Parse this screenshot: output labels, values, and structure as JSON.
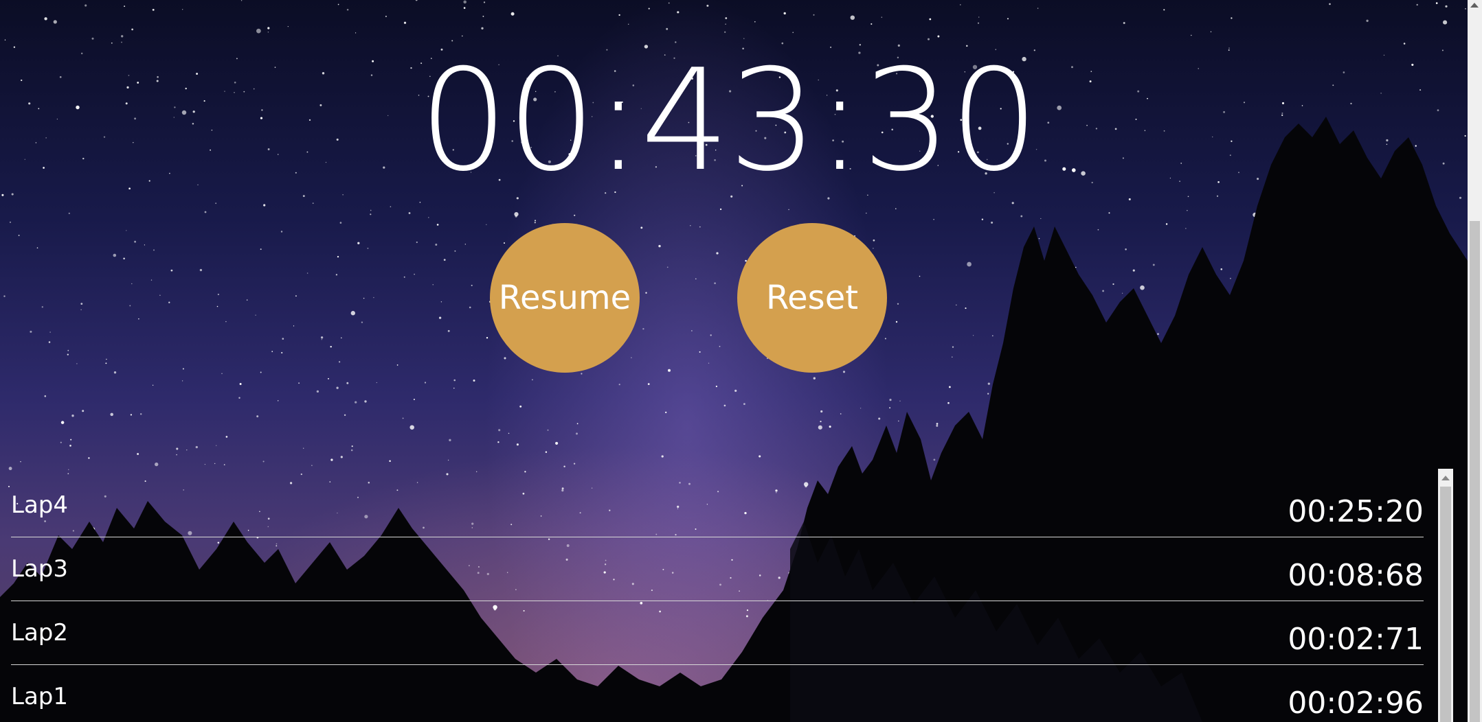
{
  "stopwatch": {
    "display": "00:43:30",
    "resume_label": "Resume",
    "reset_label": "Reset",
    "button_color": "#d4a04e"
  },
  "laps": [
    {
      "name": "Lap4",
      "time": "00:25:20"
    },
    {
      "name": "Lap3",
      "time": "00:08:68"
    },
    {
      "name": "Lap2",
      "time": "00:02:71"
    },
    {
      "name": "Lap1",
      "time": "00:02:96"
    }
  ],
  "background": {
    "description_icon": "night-sky-forest-background"
  }
}
